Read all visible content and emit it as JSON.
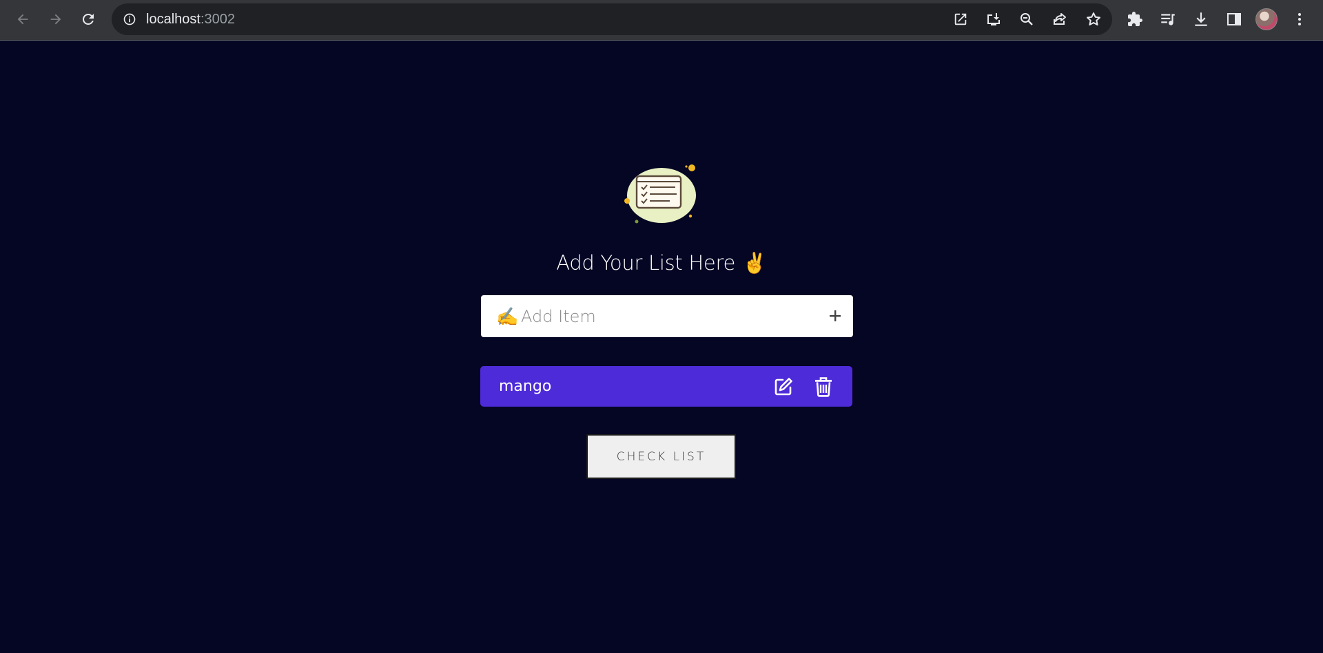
{
  "browser": {
    "url_host": "localhost",
    "url_port": ":3002",
    "icons": [
      "back-arrow-icon",
      "forward-arrow-icon",
      "reload-icon",
      "info-icon",
      "open-in-new-icon",
      "install-app-icon",
      "zoom-out-icon",
      "share-icon",
      "bookmark-star-icon",
      "extensions-icon",
      "media-queue-icon",
      "download-icon",
      "side-panel-icon",
      "profile-avatar",
      "menu-dots-icon"
    ]
  },
  "page": {
    "heading": "Add Your List Here",
    "heading_emoji": "✌️",
    "add_input": {
      "emoji": "✍️",
      "placeholder": "Add Item",
      "value": ""
    },
    "add_button_icon": "plus-icon",
    "items": [
      {
        "label": "mango"
      }
    ],
    "check_button_label": "CHECK LIST"
  },
  "colors": {
    "background": "#050524",
    "item_row": "#4e2bd9",
    "chrome": "#35363a",
    "omnibox": "#202124"
  }
}
